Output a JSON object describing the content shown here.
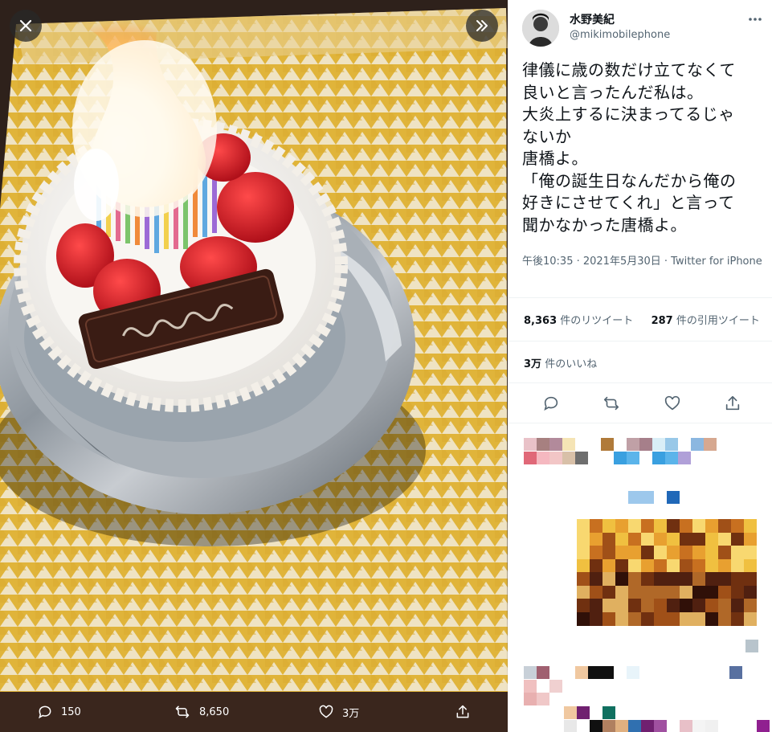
{
  "media": {
    "close_icon": "close-icon",
    "next_icon": "double-chevron-right-icon",
    "actions": [
      {
        "icon": "reply-icon",
        "count": "150"
      },
      {
        "icon": "retweet-icon",
        "count": "8,650"
      },
      {
        "icon": "like-icon",
        "count": "3万"
      },
      {
        "icon": "share-icon",
        "count": ""
      }
    ]
  },
  "tweet": {
    "display_name": "水野美紀",
    "handle": "@mikimobilephone",
    "text": "律儀に歳の数だけ立てなくて\n良いと言ったんだ私は。\n大炎上するに決まってるじゃ\nないか\n唐橋よ。\n「俺の誕生日なんだから俺の\n好きにさせてくれ」と言って\n聞かなかった唐橋よ。",
    "timestamp": "午後10:35 · 2021年5月30日 · Twitter for iPhone",
    "retweets": {
      "count": "8,363",
      "label": "件のリツイート"
    },
    "quotes": {
      "count": "287",
      "label": "件の引用ツイート"
    },
    "likes": {
      "count": "3万",
      "label": "件のいいね"
    },
    "more_icon": "more-icon",
    "action_icons": [
      "reply-icon",
      "retweet-icon",
      "like-icon",
      "share-icon"
    ]
  },
  "colors": {
    "icon": "#536471",
    "text": "#0f1419",
    "secondary": "#536471",
    "divider": "#eff3f4",
    "media_bar": "#3a261d"
  }
}
